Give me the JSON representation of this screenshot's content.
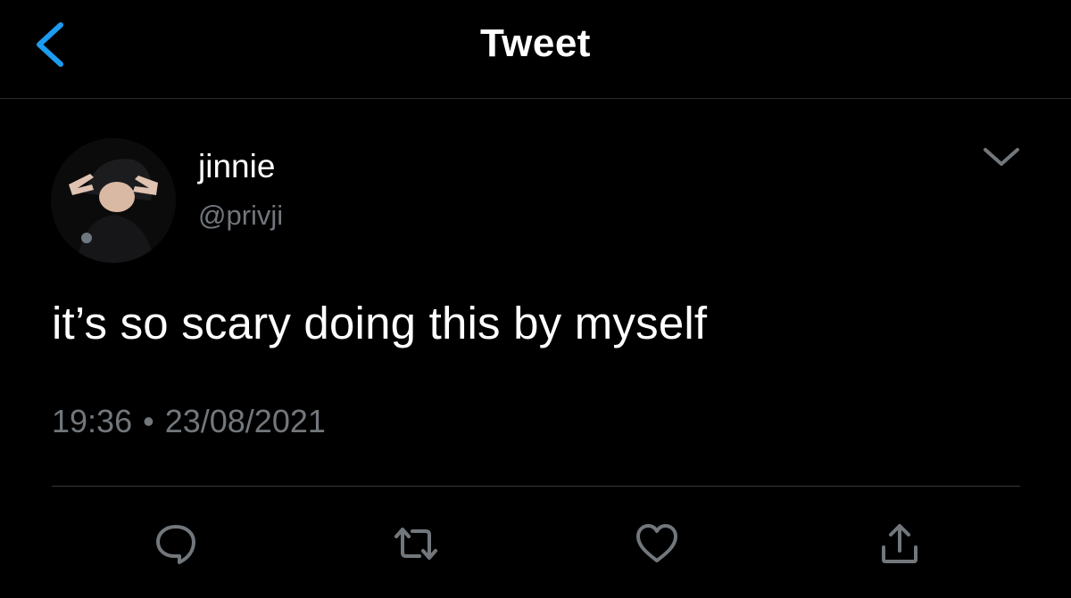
{
  "header": {
    "title": "Tweet",
    "back_icon": "chevron-left-icon"
  },
  "tweet": {
    "display_name": "jinnie",
    "handle": "@privji",
    "text": "it’s so scary doing this by myself",
    "time": "19:36",
    "separator": "•",
    "date": "23/08/2021",
    "menu_icon": "chevron-down-icon"
  },
  "actions": [
    {
      "name": "reply",
      "icon": "reply-icon"
    },
    {
      "name": "retweet",
      "icon": "retweet-icon"
    },
    {
      "name": "like",
      "icon": "heart-icon"
    },
    {
      "name": "share",
      "icon": "share-icon"
    }
  ],
  "colors": {
    "background": "#000000",
    "text": "#ffffff",
    "secondary_text": "#72777c",
    "accent": "#1d9bf0",
    "divider": "#3a3a3a"
  }
}
